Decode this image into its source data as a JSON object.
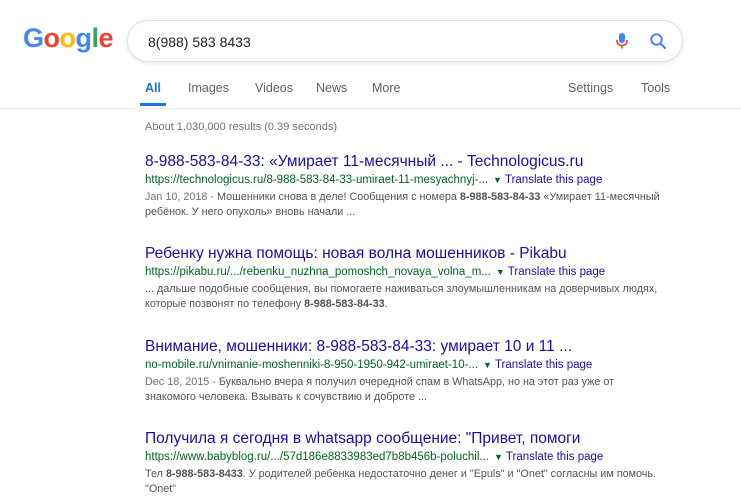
{
  "logo": {
    "letters": [
      "G",
      "o",
      "o",
      "g",
      "l",
      "e"
    ],
    "colors": [
      "#4285F4",
      "#EA4335",
      "#FBBC05",
      "#4285F4",
      "#34A853",
      "#EA4335"
    ]
  },
  "search": {
    "value": "8(988) 583 8433"
  },
  "tabs": {
    "all": "All",
    "images": "Images",
    "videos": "Videos",
    "news": "News",
    "more": "More",
    "settings": "Settings",
    "tools": "Tools"
  },
  "stats": "About 1,030,000 results (0.39 seconds)",
  "results": [
    {
      "title": "8-988-583-84-33: «Умирает 11-месячный ... - Technologicus.ru",
      "url": "https://technologicus.ru/8-988-583-84-33-umiraet-11-mesyachnyj-...",
      "translate": "Translate this page",
      "date": "Jan 10, 2018 -",
      "snip_a": " Мошенники снова в деле! Сообщения с номера ",
      "snip_b": "8-988-583-84-33",
      "snip_c": " «Умирает 11-месячный ребёнок. У него опухоль» вновь начали ..."
    },
    {
      "title": "Ребенку нужна помощь: новая волна мошенников - Pikabu",
      "url": "https://pikabu.ru/.../rebenku_nuzhna_pomoshch_novaya_volna_m...",
      "translate": "Translate this page",
      "date": "",
      "snip_a": "... дальше подобные сообщения, вы помогаете наживаться злоумышленникам на доверчивых людях, которые позвонят по телефону ",
      "snip_b": "8-988-583-84-33",
      "snip_c": "."
    },
    {
      "title": "Внимание, мошенники: 8-988-583-84-33: умирает 10 и 11 ...",
      "url": "no-mobile.ru/vnimanie-moshenniki-8-950-1950-942-umiraet-10-...",
      "translate": "Translate this page",
      "date": "Dec 18, 2015 -",
      "snip_a": " Буквально вчера я получил очередной спам в WhatsApp, но на этот раз уже от знакомого человека. Взывать к сочувствию и доброте ...",
      "snip_b": "",
      "snip_c": ""
    },
    {
      "title": "Получила я сегодня в whatsapp сообщение: \"Привет, помоги",
      "url": "https://www.babyblog.ru/.../57d186e8833983ed7b8b456b-poluchil...",
      "translate": "Translate this page",
      "date": "",
      "snip_a": "Тел ",
      "snip_b": "8-988-583-8433",
      "snip_c": ". У родителей ребенка недостаточно денег и \"Epuls\" и \"Onet\" согласны им помочь. \"Onet\""
    }
  ]
}
